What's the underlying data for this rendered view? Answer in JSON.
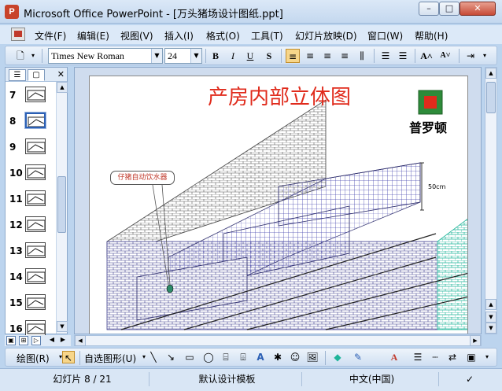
{
  "window": {
    "title": "Microsoft Office PowerPoint - [万头猪场设计图纸.ppt]",
    "app_icon": "P"
  },
  "menu": {
    "items": [
      "文件(F)",
      "编辑(E)",
      "视图(V)",
      "插入(I)",
      "格式(O)",
      "工具(T)",
      "幻灯片放映(D)",
      "窗口(W)",
      "帮助(H)"
    ]
  },
  "formatting": {
    "font_name": "Times New Roman",
    "font_size": "24",
    "bold": "B",
    "italic": "I",
    "underline": "U",
    "shadow": "S"
  },
  "thumbnails": [
    {
      "num": "7"
    },
    {
      "num": "8",
      "selected": true
    },
    {
      "num": "9"
    },
    {
      "num": "10"
    },
    {
      "num": "11"
    },
    {
      "num": "12"
    },
    {
      "num": "13"
    },
    {
      "num": "14"
    },
    {
      "num": "15"
    },
    {
      "num": "16"
    }
  ],
  "slide": {
    "title": "产房内部立体图",
    "logo_text": "普罗顿",
    "callout": "仔猪自动饮水器",
    "dimension": "50cm",
    "colors": {
      "title": "#e02b1c",
      "brick": "#3a3a8c",
      "teal": "#1fb59a",
      "logo_green": "#2e8b3a"
    }
  },
  "drawing": {
    "draw_label": "绘图(R)",
    "autoshapes_label": "自选图形(U)"
  },
  "status": {
    "slide_info": "幻灯片 8 / 21",
    "template": "默认设计模板",
    "language": "中文(中国)"
  }
}
